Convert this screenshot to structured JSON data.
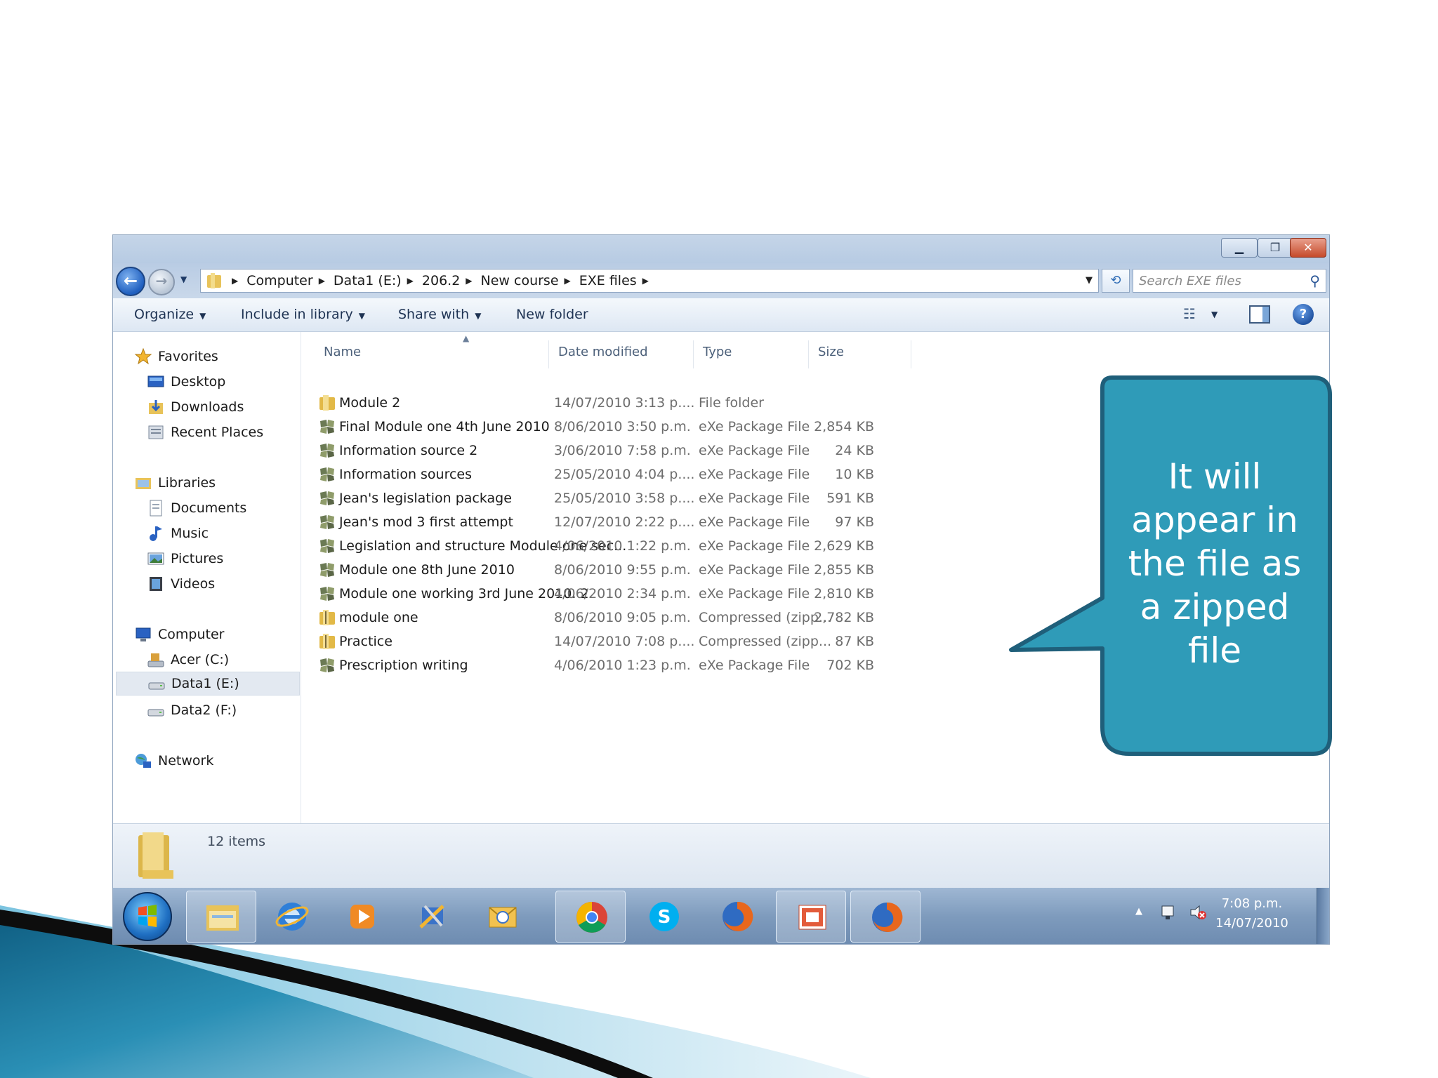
{
  "colors": {
    "accent": "#2f9bb8",
    "accent_border": "#1f5f7a",
    "toolbar_text": "#1e3353",
    "muted_text": "#6d6d6d"
  },
  "address": {
    "crumbs": [
      "Computer",
      "Data1 (E:)",
      "206.2",
      "New course",
      "EXE files"
    ]
  },
  "search": {
    "placeholder": "Search EXE files"
  },
  "toolbar": {
    "organize": "Organize",
    "include": "Include in library",
    "share": "Share with",
    "new_folder": "New folder"
  },
  "nav": {
    "favorites": "Favorites",
    "desktop": "Desktop",
    "downloads": "Downloads",
    "recent": "Recent Places",
    "libraries": "Libraries",
    "documents": "Documents",
    "music": "Music",
    "pictures": "Pictures",
    "videos": "Videos",
    "computer": "Computer",
    "acer": "Acer (C:)",
    "data1": "Data1 (E:)",
    "data2": "Data2 (F:)",
    "network": "Network"
  },
  "columns": {
    "name": "Name",
    "date": "Date modified",
    "type": "Type",
    "size": "Size"
  },
  "files": [
    {
      "icon": "folder-icon",
      "name": "Module 2",
      "date": "14/07/2010 3:13 p....",
      "type": "File folder",
      "size": ""
    },
    {
      "icon": "exe-package-icon",
      "name": "Final Module one 4th June 2010",
      "date": "8/06/2010 3:50 p.m.",
      "type": "eXe Package File",
      "size": "2,854 KB"
    },
    {
      "icon": "exe-package-icon",
      "name": "Information source 2",
      "date": "3/06/2010 7:58 p.m.",
      "type": "eXe Package File",
      "size": "24 KB"
    },
    {
      "icon": "exe-package-icon",
      "name": "Information sources",
      "date": "25/05/2010 4:04 p....",
      "type": "eXe Package File",
      "size": "10 KB"
    },
    {
      "icon": "exe-package-icon",
      "name": "Jean's legislation package",
      "date": "25/05/2010 3:58 p....",
      "type": "eXe Package File",
      "size": "591 KB"
    },
    {
      "icon": "exe-package-icon",
      "name": "Jean's mod 3 first attempt",
      "date": "12/07/2010 2:22 p....",
      "type": "eXe Package File",
      "size": "97 KB"
    },
    {
      "icon": "exe-package-icon",
      "name": "Legislation and structure Module one sec...",
      "date": "4/06/2010 1:22 p.m.",
      "type": "eXe Package File",
      "size": "2,629 KB"
    },
    {
      "icon": "exe-package-icon",
      "name": "Module one 8th June 2010",
      "date": "8/06/2010 9:55 p.m.",
      "type": "eXe Package File",
      "size": "2,855 KB"
    },
    {
      "icon": "exe-package-icon",
      "name": "Module one working 3rd June 2010. 2",
      "date": "4/06/2010 2:34 p.m.",
      "type": "eXe Package File",
      "size": "2,810 KB"
    },
    {
      "icon": "zip-folder-icon",
      "name": "module one",
      "date": "8/06/2010 9:05 p.m.",
      "type": "Compressed (zipp...",
      "size": "2,782 KB"
    },
    {
      "icon": "zip-folder-icon",
      "name": "Practice",
      "date": "14/07/2010 7:08 p....",
      "type": "Compressed (zipp...",
      "size": "87 KB"
    },
    {
      "icon": "exe-package-icon",
      "name": "Prescription writing",
      "date": "4/06/2010 1:23 p.m.",
      "type": "eXe Package File",
      "size": "702 KB"
    }
  ],
  "details": {
    "count": "12 items"
  },
  "taskbar": {
    "apps": [
      "start-orb",
      "windows-explorer-icon",
      "internet-explorer-icon",
      "media-player-icon",
      "tools-icon",
      "outlook-icon",
      "chrome-icon",
      "skype-icon",
      "firefox-icon",
      "powerpoint-icon",
      "firefox-icon"
    ],
    "time": "7:08 p.m.",
    "date": "14/07/2010"
  },
  "callout": {
    "line1": "It will",
    "line2": "appear in",
    "line3": "the file as",
    "line4": "a zipped",
    "line5": "file"
  }
}
